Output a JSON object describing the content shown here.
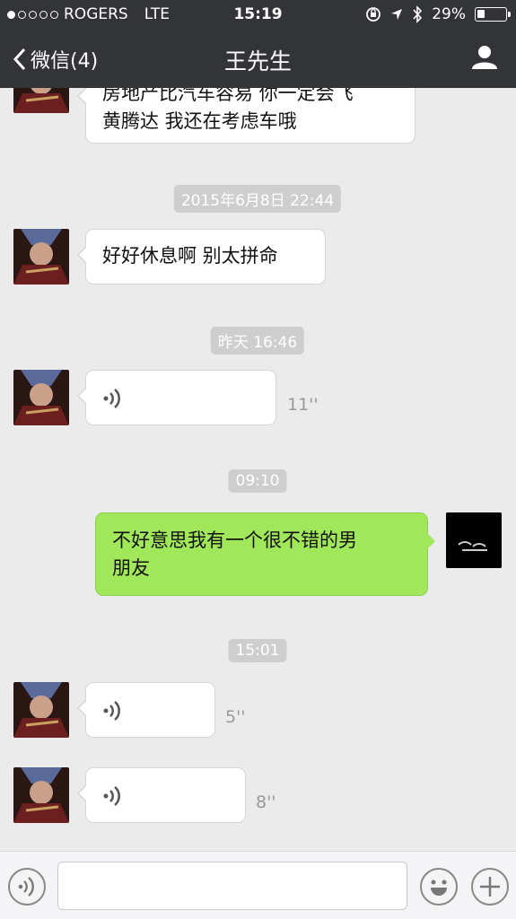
{
  "status": {
    "carrier": "ROGERS",
    "network": "LTE",
    "time": "15:19",
    "battery": "29%",
    "battery_level": 0.29
  },
  "nav": {
    "back_label": "微信(4)",
    "title": "王先生"
  },
  "messages": {
    "m1_line1": "房地产比汽车容易 你一定会飞",
    "m1_line2": "黄腾达  我还在考虑车哦",
    "ts1": "2015年6月8日 22:44",
    "m2": "好好休息啊 别太拼命",
    "ts2": "昨天 16:46",
    "voice1_duration": "11''",
    "ts3": "09:10",
    "m3_line1": "不好意思我有一个很不错的男",
    "m3_line2": "朋友",
    "ts4": "15:01",
    "voice2_duration": "5''",
    "voice3_duration": "8''"
  },
  "input": {
    "value": "",
    "placeholder": ""
  },
  "colors": {
    "bar": "#333438",
    "sent_bubble": "#a0e75a",
    "background": "#ebebeb"
  }
}
